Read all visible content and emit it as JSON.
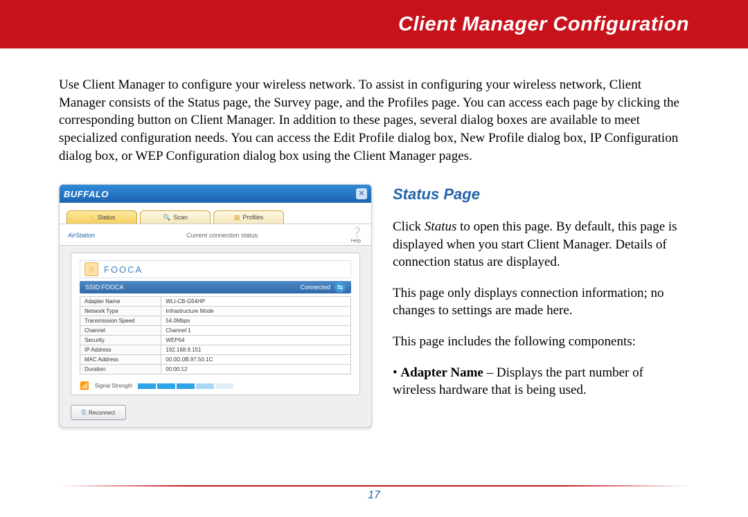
{
  "header": {
    "title": "Client Manager Configuration"
  },
  "intro": "Use Client Manager to configure your wireless network. To assist in configuring your wireless network, Client Manager consists of the Status page, the Survey page, and the Profiles page. You can access each page by clicking the corresponding button on Client Manager. In addition to these pages, several dialog boxes are available to meet specialized configuration needs. You can access the Edit Profile dialog box, New Profile dialog box, IP Configuration dialog box, or WEP Configuration dialog box using the Client Manager pages.",
  "screenshot": {
    "brand": "BUFFALO",
    "tabs": {
      "status": "Status",
      "scan": "Scan",
      "profiles": "Profiles"
    },
    "airstation": "AirStation",
    "subtitle": "Current connection status.",
    "help": "Help",
    "profile_name": "FOOCA",
    "ssid_label": "SSID:FOOCA",
    "connected": "Connected",
    "rows": [
      {
        "k": "Adapter Name",
        "v": "WLI-CB-G54HP"
      },
      {
        "k": "Network Type",
        "v": "Infrastructure Mode"
      },
      {
        "k": "Transmission Speed",
        "v": "54.0Mbps"
      },
      {
        "k": "Channel",
        "v": "Channel 1"
      },
      {
        "k": "Security",
        "v": "WEP64"
      },
      {
        "k": "IP Address",
        "v": "192.168.9.151"
      },
      {
        "k": "MAC Address",
        "v": "00.0D.0B.97.50.1C"
      },
      {
        "k": "Duration",
        "v": "00:00:12"
      }
    ],
    "signal_label": "Signal Strength",
    "reconnect": "Reconnect"
  },
  "section": {
    "title": "Status Page",
    "p1a": "Click ",
    "p1b": "Status",
    "p1c": " to open this page. By default, this page is displayed when you start Client Manager. Details of connection status are displayed.",
    "p2": "This page only displays connection information; no changes to settings are made here.",
    "p3": "This page includes the following components:",
    "bullet_label": "Adapter Name",
    "bullet_text": " – Displays the part number of wireless hardware that is being used."
  },
  "page_number": "17"
}
